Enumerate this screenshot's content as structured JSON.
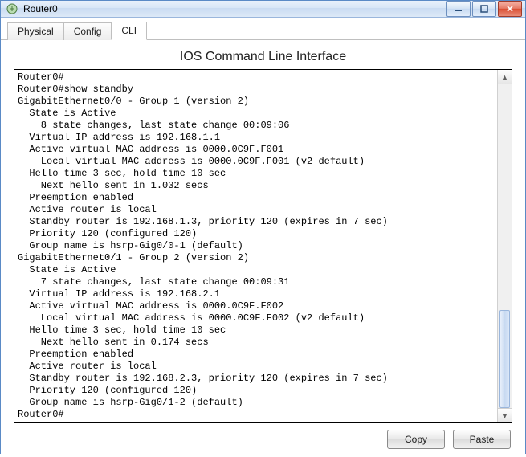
{
  "window": {
    "title": "Router0"
  },
  "tabs": {
    "physical": "Physical",
    "config": "Config",
    "cli": "CLI"
  },
  "panel": {
    "heading": "IOS Command Line Interface"
  },
  "cli_output": "Router0#\nRouter0#show standby\nGigabitEthernet0/0 - Group 1 (version 2)\n  State is Active\n    8 state changes, last state change 00:09:06\n  Virtual IP address is 192.168.1.1\n  Active virtual MAC address is 0000.0C9F.F001\n    Local virtual MAC address is 0000.0C9F.F001 (v2 default)\n  Hello time 3 sec, hold time 10 sec\n    Next hello sent in 1.032 secs\n  Preemption enabled\n  Active router is local\n  Standby router is 192.168.1.3, priority 120 (expires in 7 sec)\n  Priority 120 (configured 120)\n  Group name is hsrp-Gig0/0-1 (default)\nGigabitEthernet0/1 - Group 2 (version 2)\n  State is Active\n    7 state changes, last state change 00:09:31\n  Virtual IP address is 192.168.2.1\n  Active virtual MAC address is 0000.0C9F.F002\n    Local virtual MAC address is 0000.0C9F.F002 (v2 default)\n  Hello time 3 sec, hold time 10 sec\n    Next hello sent in 0.174 secs\n  Preemption enabled\n  Active router is local\n  Standby router is 192.168.2.3, priority 120 (expires in 7 sec)\n  Priority 120 (configured 120)\n  Group name is hsrp-Gig0/1-2 (default)\nRouter0#",
  "buttons": {
    "copy": "Copy",
    "paste": "Paste"
  }
}
